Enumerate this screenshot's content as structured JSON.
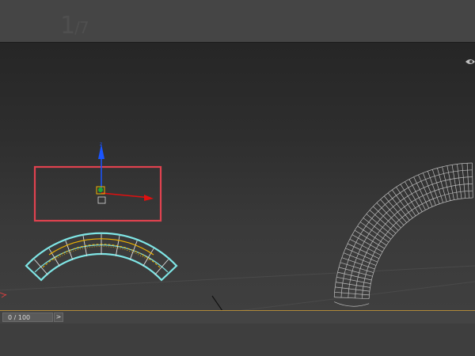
{
  "step": {
    "current": "1",
    "separator_total": "/7"
  },
  "timeline": {
    "frame_readout": "0 / 100",
    "next_label": ">"
  },
  "colors": {
    "selection_box": "#e0424f",
    "selected_object": "#7fe6e6",
    "wire_inner": "#d8d8d8",
    "subobject_edges": "#f0b400",
    "gizmo_z": "#1a55ff",
    "gizmo_x": "#e01010",
    "gizmo_y": "#19a83a",
    "background_mesh": "#bdbdbd"
  },
  "icons": {
    "transform_gizmo": "move-gizmo-icon",
    "eye": "eye-icon",
    "axis_tripod": "axis-tripod-icon"
  }
}
